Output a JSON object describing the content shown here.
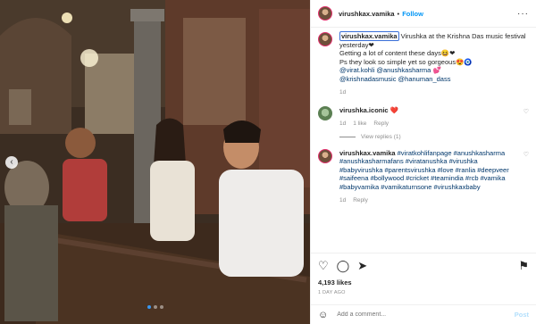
{
  "header": {
    "username": "virushkax.vamika",
    "separator": "•",
    "follow_label": "Follow",
    "more_label": "···"
  },
  "caption": {
    "username": "virushkax.vamika",
    "text_1": "Virushka at the Krishna Das music festival yesterday",
    "emoji_1": "❤",
    "text_2": "Getting a lot of content these days",
    "emoji_2": "😆❤",
    "text_3": "Ps they look so simple yet so gorgeous",
    "emoji_3": "😍🧿",
    "mentions_1": "@virat.kohli @anushkasharma",
    "emoji_4": "💕",
    "mentions_2": "@krishnadasmusic @hanuman_dass",
    "time": "1d"
  },
  "comments": [
    {
      "username": "virushka.iconic",
      "text": "❤️",
      "time": "1d",
      "likes": "1 like",
      "reply": "Reply",
      "view_replies": "View replies (1)"
    },
    {
      "username": "virushkax.vamika",
      "text": "#viratkohlifanpage #anushkasharma #anushkasharmafans #viratanushka #virushka #babyvirushka #parentsvirushka #love #ranlia #deepveer #saifeena #bollywood #cricket #teamindia #rcb #vamika #babyvamika #vamikaturnsone #virushkaxbaby",
      "time": "1d",
      "reply": "Reply"
    }
  ],
  "actions": {
    "likes": "4,193 likes",
    "posted_ago": "1 DAY AGO"
  },
  "comment_box": {
    "placeholder": "Add a comment...",
    "post_label": "Post"
  },
  "carousel": {
    "prev_icon": "chevron-left-icon",
    "slides": 3,
    "active": 0
  }
}
